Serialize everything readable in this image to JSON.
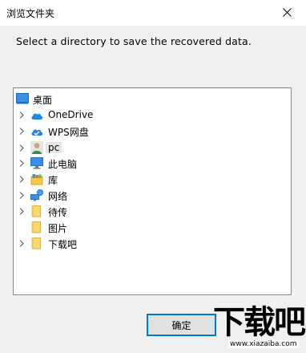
{
  "window": {
    "title": "浏览文件夹"
  },
  "instruction": "Select a directory to save the recovered data.",
  "tree": {
    "items": [
      {
        "label": "桌面",
        "icon": "desktop-icon",
        "expandable": false
      },
      {
        "label": "OneDrive",
        "icon": "cloud-icon",
        "expandable": true
      },
      {
        "label": "WPS网盘",
        "icon": "wps-cloud-icon",
        "expandable": true
      },
      {
        "label": "pc",
        "icon": "user-icon",
        "expandable": true,
        "selected": true
      },
      {
        "label": "此电脑",
        "icon": "computer-icon",
        "expandable": true
      },
      {
        "label": "库",
        "icon": "library-icon",
        "expandable": true
      },
      {
        "label": "网络",
        "icon": "network-icon",
        "expandable": true
      },
      {
        "label": "待传",
        "icon": "folder-icon",
        "expandable": true
      },
      {
        "label": "图片",
        "icon": "folder-icon",
        "expandable": false
      },
      {
        "label": "下载吧",
        "icon": "folder-icon",
        "expandable": true
      }
    ]
  },
  "buttons": {
    "ok_label": "确定"
  },
  "watermark": {
    "text": "下载吧",
    "url": "www.xiazaiba.com"
  },
  "colors": {
    "accent": "#0078d7",
    "cloud": "#1e88e5",
    "folder": "#f8d775"
  }
}
